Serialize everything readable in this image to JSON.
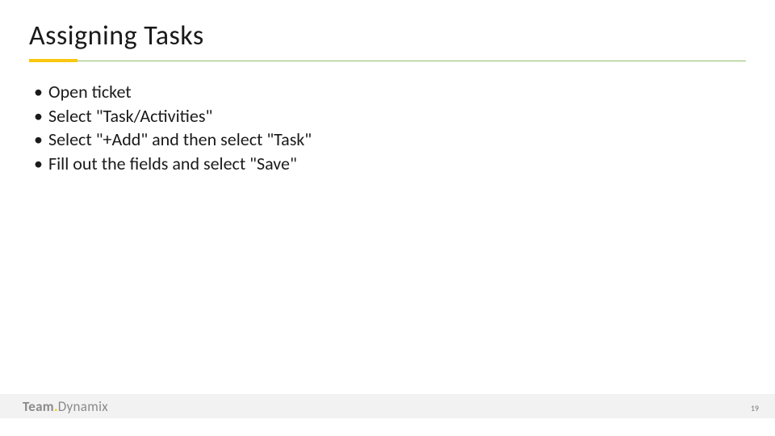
{
  "title": "Assigning Tasks",
  "bullets": {
    "items": [
      "Open ticket",
      "Select \"Task/Activities\"",
      "Select \"+Add\" and then select \"Task\"",
      "Fill out the fields and select \"Save\""
    ]
  },
  "footer": {
    "logo_part1": "Team",
    "logo_dot": ".",
    "logo_part2": "Dynamix",
    "page_number": "19"
  }
}
